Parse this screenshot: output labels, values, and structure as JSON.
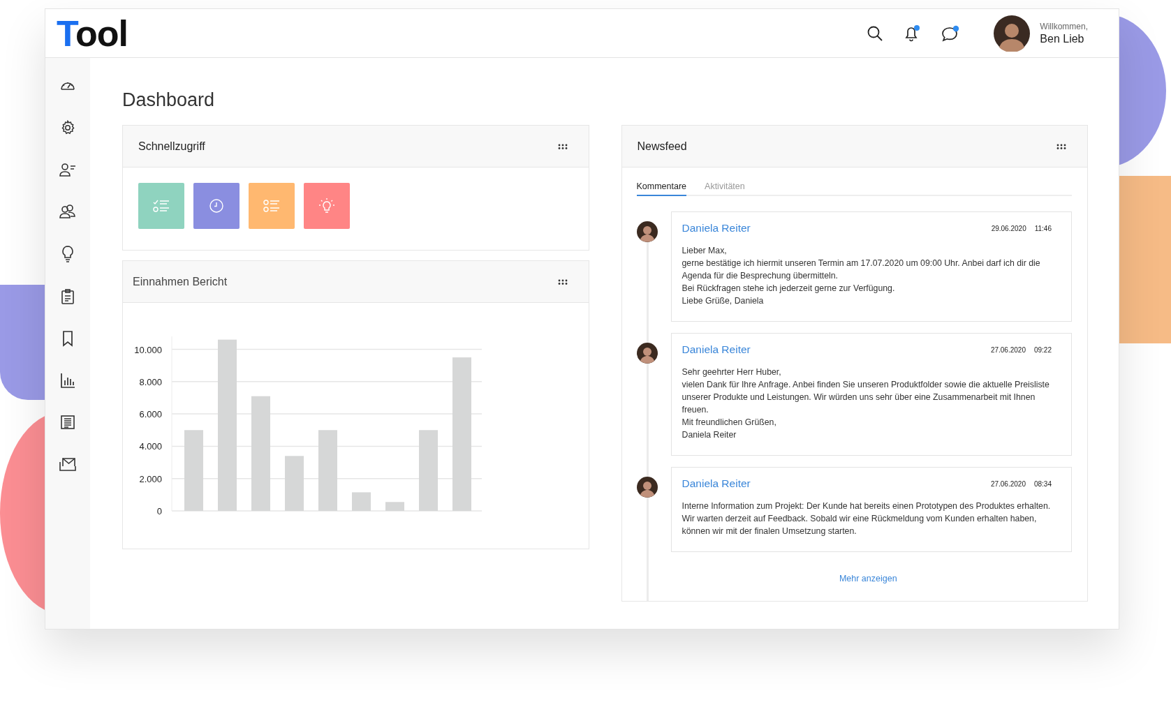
{
  "header": {
    "logo": {
      "accent": "T",
      "text": "ool"
    },
    "greeting": "Willkommen,",
    "user_name": "Ben Lieb"
  },
  "page_title": "Dashboard",
  "quick_access": {
    "title": "Schnellzugriff",
    "tiles": [
      {
        "color": "#8fd3bf"
      },
      {
        "color": "#8a8ee0"
      },
      {
        "color": "#ffb870"
      },
      {
        "color": "#ff8585"
      }
    ]
  },
  "revenue_report": {
    "title": "Einnahmen Bericht",
    "chart_data": {
      "type": "bar",
      "values": [
        5000,
        10600,
        7100,
        3400,
        5000,
        1150,
        550,
        5000,
        9500
      ],
      "grid": true,
      "ylim": [
        0,
        10800
      ],
      "yticks": [
        {
          "value": 0,
          "label": "0"
        },
        {
          "value": 2000,
          "label": "2.000"
        },
        {
          "value": 4000,
          "label": "4.000"
        },
        {
          "value": 6000,
          "label": "6.000"
        },
        {
          "value": 8000,
          "label": "8.000"
        },
        {
          "value": 10000,
          "label": "10.000"
        }
      ]
    }
  },
  "newsfeed": {
    "title": "Newsfeed",
    "tabs": [
      {
        "label": "Kommentare",
        "selected": true
      },
      {
        "label": "Aktivitäten",
        "selected": false
      }
    ],
    "posts": [
      {
        "author": "Daniela Reiter",
        "date": "29.06.2020",
        "time": "11:46",
        "text": "Lieber Max,\ngerne bestätige ich hiermit unseren Termin am 17.07.2020 um 09:00 Uhr. Anbei darf ich dir die Agenda für die Besprechung übermitteln.\nBei Rückfragen stehe ich jederzeit gerne zur Verfügung.\nLiebe Grüße, Daniela"
      },
      {
        "author": "Daniela Reiter",
        "date": "27.06.2020",
        "time": "09:22",
        "text": "Sehr geehrter Herr Huber,\nvielen Dank für Ihre Anfrage. Anbei finden Sie unseren Produktfolder sowie die aktuelle Preisliste unserer Produkte und Leistungen. Wir würden uns sehr über eine Zusammenarbeit mit Ihnen freuen.\nMit freundlichen Grüßen,\nDaniela Reiter"
      },
      {
        "author": "Daniela Reiter",
        "date": "27.06.2020",
        "time": "08:34",
        "text": "Interne Information zum Projekt: Der Kunde hat bereits einen Prototypen des Produktes erhalten. Wir warten derzeit auf Feedback. Sobald wir eine Rückmeldung vom Kunden erhalten haben, können wir mit der finalen Umsetzung starten."
      }
    ],
    "more_link": "Mehr anzeigen"
  }
}
